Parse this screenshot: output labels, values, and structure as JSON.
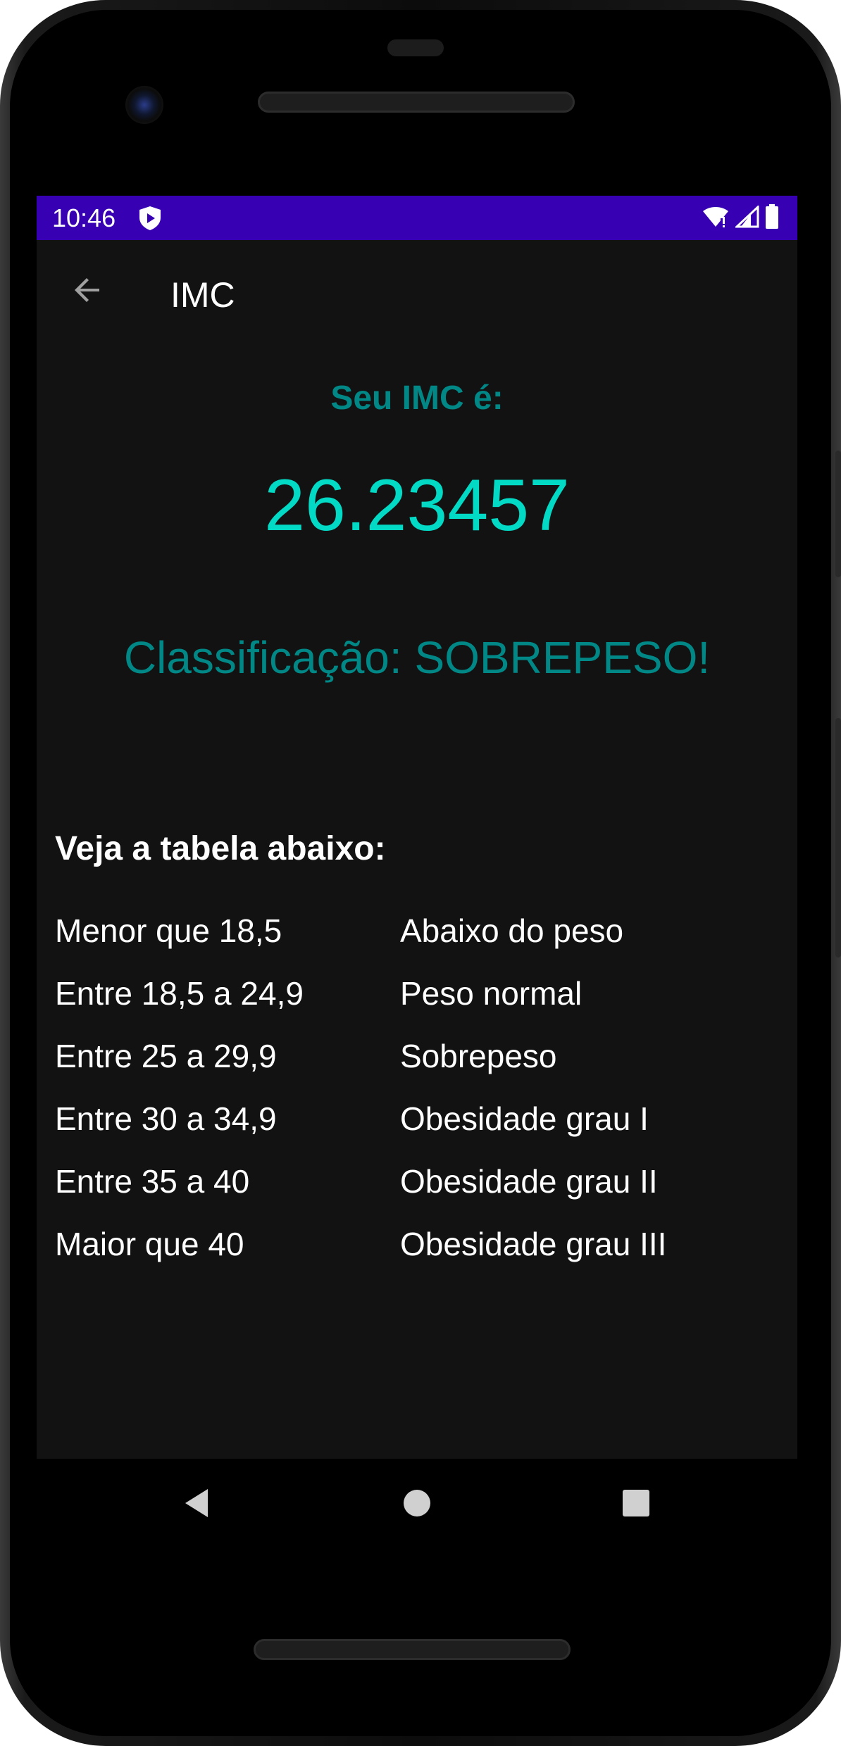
{
  "status_bar": {
    "time": "10:46"
  },
  "app_bar": {
    "title": "IMC"
  },
  "result": {
    "label": "Seu IMC é:",
    "value": "26.23457",
    "classification": "Classificação: SOBREPESO!"
  },
  "table": {
    "title": "Veja a tabela abaixo:",
    "rows": [
      {
        "range": "Menor que 18,5",
        "category": "Abaixo do peso"
      },
      {
        "range": "Entre 18,5 a 24,9",
        "category": "Peso normal"
      },
      {
        "range": "Entre 25 a 29,9",
        "category": "Sobrepeso"
      },
      {
        "range": "Entre 30 a 34,9",
        "category": "Obesidade grau I"
      },
      {
        "range": "Entre 35 a 40",
        "category": "Obesidade grau II"
      },
      {
        "range": "Maior que 40",
        "category": "Obesidade grau III"
      }
    ]
  },
  "icons": {
    "back": "arrow-back-icon",
    "shield": "shield-play-icon",
    "wifi": "wifi-icon",
    "signal": "cell-signal-icon",
    "battery": "battery-icon",
    "nav_back": "nav-back-triangle-icon",
    "nav_home": "nav-home-circle-icon",
    "nav_recents": "nav-recents-square-icon"
  },
  "colors": {
    "status_bar": "#3700b3",
    "background": "#121212",
    "label_teal": "#018786",
    "value_teal": "#03dac5",
    "text_white": "#ffffff"
  }
}
